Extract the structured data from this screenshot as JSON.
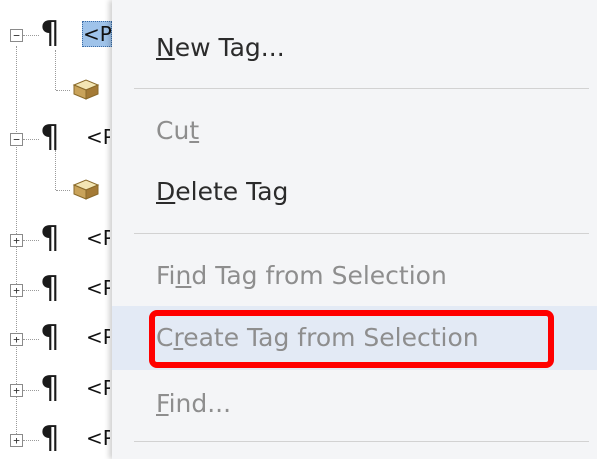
{
  "tree": {
    "rows": [
      {
        "expander": "−",
        "label": "<P",
        "selected": true
      },
      {
        "expander": "−",
        "label": "<P",
        "selected": false
      },
      {
        "expander": "+",
        "label": "<P",
        "selected": false
      },
      {
        "expander": "+",
        "label": "<P",
        "selected": false
      },
      {
        "expander": "+",
        "label": "<P",
        "selected": false
      },
      {
        "expander": "+",
        "label": "<P",
        "selected": false
      },
      {
        "expander": "+",
        "label": "<P",
        "selected": false
      }
    ],
    "paragraph_glyph": "¶"
  },
  "context_menu": {
    "items": [
      {
        "pre": "",
        "key": "N",
        "post": "ew Tag...",
        "enabled": true
      },
      {
        "pre": "Cu",
        "key": "t",
        "post": "",
        "enabled": false
      },
      {
        "pre": "",
        "key": "D",
        "post": "elete Tag",
        "enabled": true
      },
      {
        "pre": "Fi",
        "key": "n",
        "post": "d Tag from Selection",
        "enabled": false
      },
      {
        "pre": "C",
        "key": "r",
        "post": "eate Tag from Selection",
        "enabled": false,
        "hovered": true,
        "highlighted": true
      },
      {
        "pre": "",
        "key": "F",
        "post": "ind...",
        "enabled": false
      }
    ]
  },
  "colors": {
    "highlight_border": "#ff0000",
    "selection_bg": "#9fc3ea",
    "menu_bg": "#f4f5f7",
    "hover_bg": "#e3eaf5"
  }
}
